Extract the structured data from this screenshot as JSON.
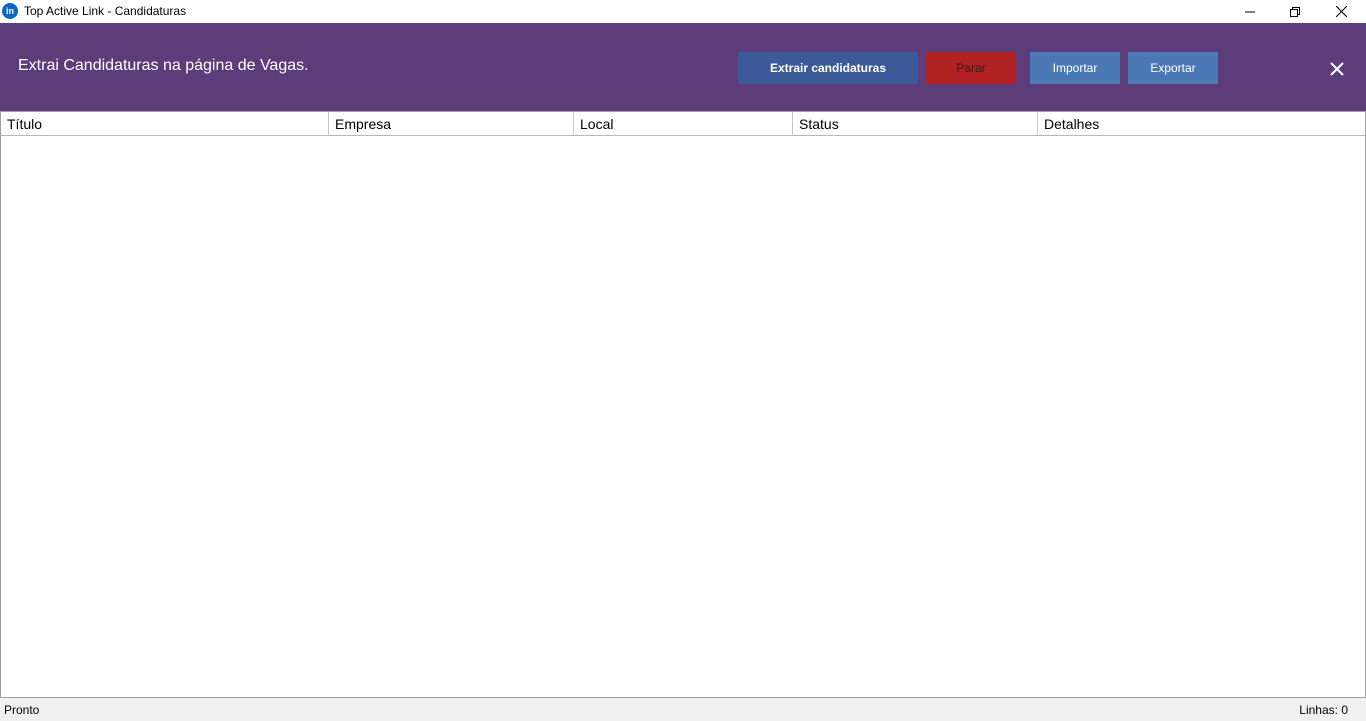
{
  "window": {
    "app_icon_text": "in",
    "title": "Top Active Link - Candidaturas"
  },
  "header": {
    "description": "Extrai Candidaturas na página de Vagas.",
    "buttons": {
      "extract": "Extrair candidaturas",
      "stop": "Parar",
      "import": "Importar",
      "export": "Exportar"
    }
  },
  "table": {
    "columns": [
      "Título",
      "Empresa",
      "Local",
      "Status",
      "Detalhes"
    ],
    "rows": []
  },
  "status": {
    "text": "Pronto",
    "lines_label": "Linhas: 0"
  },
  "colors": {
    "header_bg": "#5c3c79",
    "extract_button": "#3d5a98",
    "stop_button": "#b12121",
    "secondary_buttons": "#4b79b5"
  },
  "icons": {
    "app": "linkedin-icon",
    "minimize": "minimize-icon",
    "maximize": "restore-icon",
    "close": "close-icon",
    "panel_close": "close-icon"
  }
}
